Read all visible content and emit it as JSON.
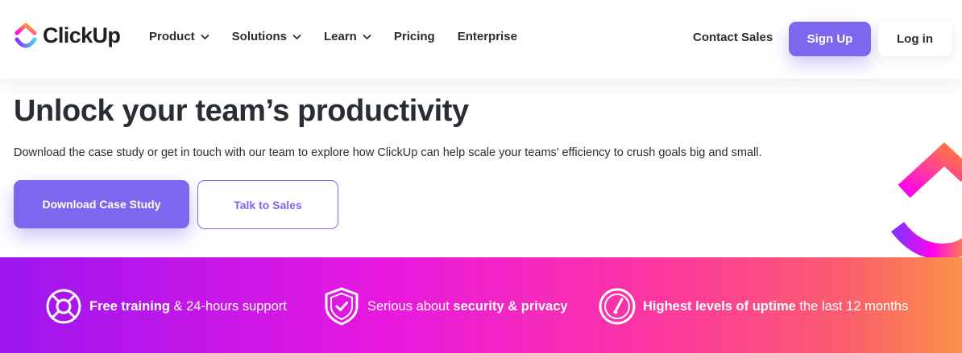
{
  "brand": {
    "name": "ClickUp",
    "colors": {
      "primary": "#7b68ee",
      "pink": "#ff02f0",
      "orange": "#ffc800",
      "purple": "#8930fd",
      "text": "#292d34"
    }
  },
  "nav": {
    "menu": [
      {
        "label": "Product",
        "has_dropdown": true
      },
      {
        "label": "Solutions",
        "has_dropdown": true
      },
      {
        "label": "Learn",
        "has_dropdown": true
      },
      {
        "label": "Pricing",
        "has_dropdown": false
      },
      {
        "label": "Enterprise",
        "has_dropdown": false
      }
    ],
    "contact_label": "Contact Sales",
    "signup_label": "Sign Up",
    "login_label": "Log in"
  },
  "hero": {
    "title": "Unlock your team’s productivity",
    "description": "Download the case study or get in touch with our team to explore how ClickUp can help scale your teams’ efficiency to crush goals big and small.",
    "primary_cta": "Download Case Study",
    "secondary_cta": "Talk to Sales"
  },
  "features": [
    {
      "icon": "lifebuoy-icon",
      "bold": "Free training",
      "rest": " & 24-hours support",
      "bold_first": true
    },
    {
      "icon": "shield-check-icon",
      "rest": "Serious about ",
      "bold": "security & privacy",
      "bold_first": false
    },
    {
      "icon": "gauge-icon",
      "bold": "Highest levels of uptime",
      "rest": " the last 12 months",
      "bold_first": true
    }
  ]
}
